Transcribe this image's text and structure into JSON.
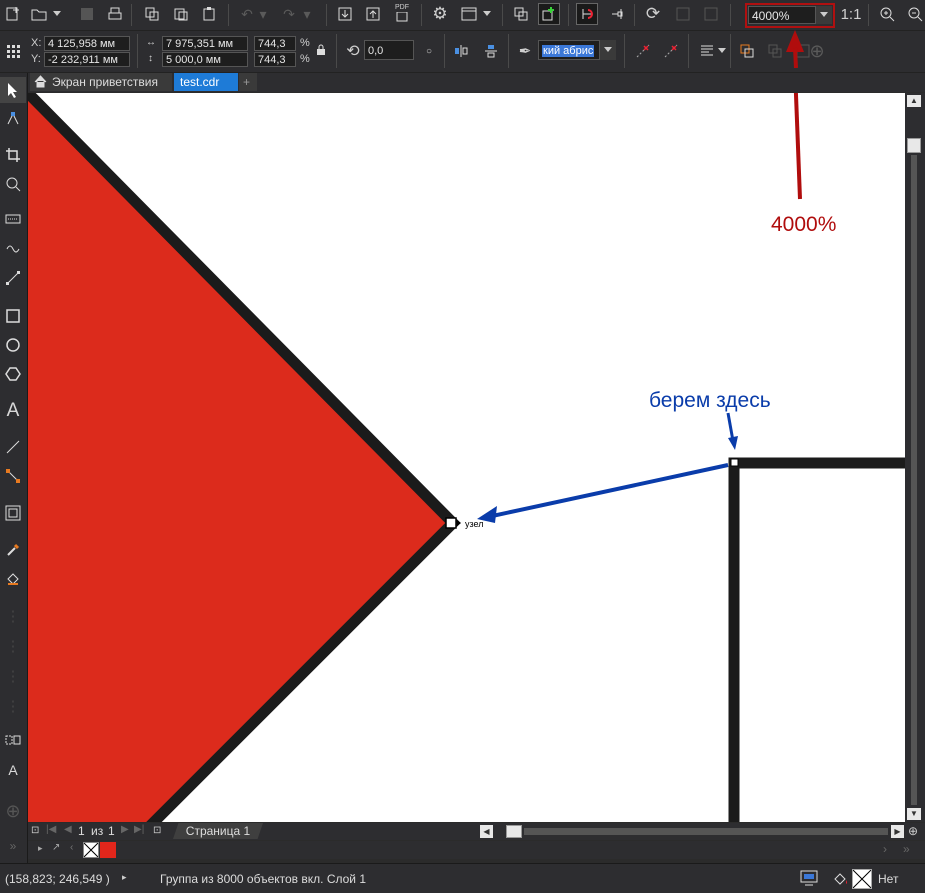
{
  "toolbar": {
    "zoom_value": "4000%",
    "one_to_one": "1:1",
    "pdf_label": "PDF",
    "icons": [
      "new-document-icon",
      "open-folder-icon",
      "save-icon",
      "print-icon",
      "import-icon",
      "export-icon",
      "publish-pdf-icon",
      "options-gear-icon",
      "view-icon",
      "snap-icon",
      "zoom-in-icon",
      "zoom-out-icon"
    ]
  },
  "propbar": {
    "x_label": "X:",
    "x_value": "4 125,958 мм",
    "y_label": "Y:",
    "y_value": "-2 232,911 мм",
    "width_value": "7 975,351 мм",
    "height_value": "5 000,0 мм",
    "scale_x": "744,3",
    "scale_y": "744,3",
    "percent": "%",
    "rotation": "0,0",
    "outline_value": "кий абрис"
  },
  "tabs": [
    {
      "label": "Экран приветствия",
      "active": false
    },
    {
      "label": "test.cdr",
      "active": true
    }
  ],
  "canvas": {
    "node_label": "узел",
    "annotation_zoom": "4000%",
    "annotation_grab": "берем здесь",
    "fill_color": "#dc2b1c",
    "outline_color": "#1b1b1b",
    "arrow_red": "#b00d0d",
    "arrow_blue": "#0a3caa"
  },
  "pager": {
    "current": "1",
    "of": "из",
    "total": "1",
    "page_tab": "Страница 1"
  },
  "status": {
    "coords": "(158,823; 246,549 )",
    "selection": "Группа из 8000 объектов вкл. Слой 1",
    "fill_none": "Нет"
  }
}
